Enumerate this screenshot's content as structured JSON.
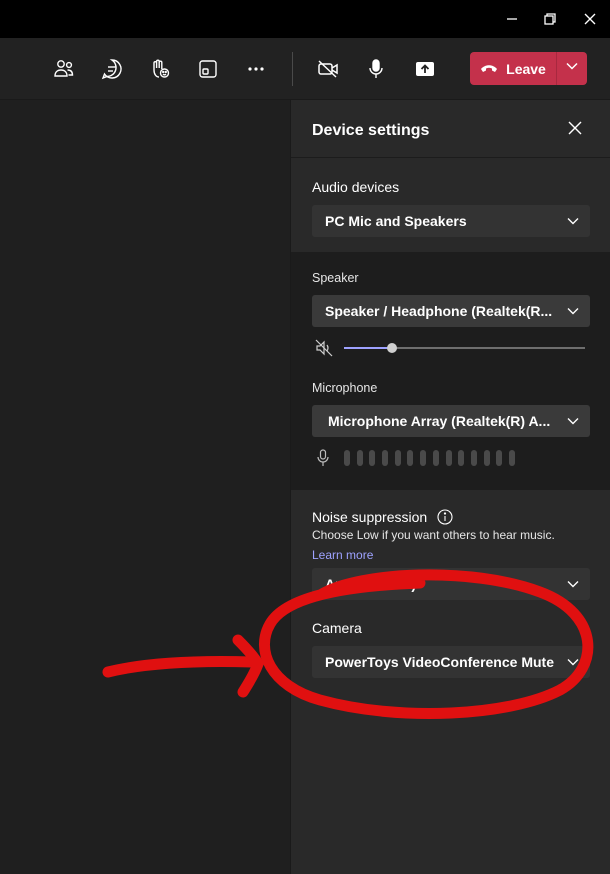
{
  "window": {
    "minimize_icon": "minimize-icon",
    "restore_icon": "restore-icon",
    "close_icon": "close-icon"
  },
  "toolbar": {
    "icons": [
      "people-icon",
      "chat-icon",
      "reactions-icon",
      "rooms-icon",
      "more-icon",
      "camera-off-icon",
      "mic-icon",
      "share-icon"
    ],
    "leave_label": "Leave",
    "leave_color": "#c4314b"
  },
  "panel": {
    "title": "Device settings",
    "audio_devices_label": "Audio devices",
    "audio_devices_value": "PC Mic and Speakers",
    "speaker_label": "Speaker",
    "speaker_value": "Speaker / Headphone (Realtek(R...",
    "speaker_volume": 0.2,
    "microphone_label": "Microphone",
    "microphone_value": "Microphone Array (Realtek(R) A...",
    "mic_level_bars": 14,
    "noise_label": "Noise suppression",
    "noise_desc": "Choose Low if you want others to hear music.",
    "learn_more": "Learn more",
    "noise_value": "Auto (default)",
    "camera_label": "Camera",
    "camera_value": "PowerToys VideoConference Mute"
  },
  "colors": {
    "accent": "#9ea2ff",
    "annotation": "#e01010"
  }
}
